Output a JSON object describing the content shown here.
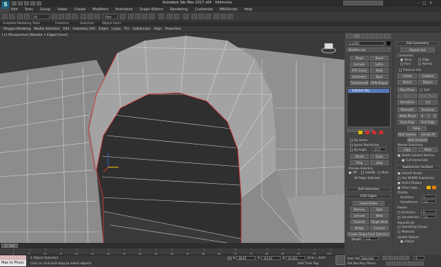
{
  "app": {
    "title": "Autodesk 3ds Max 2017 x64",
    "file": "Xdbmclsa",
    "search_placeholder": "Type a keyword or phrase"
  },
  "menu": [
    "Edit",
    "Tools",
    "Group",
    "Views",
    "Create",
    "Modifiers",
    "Animation",
    "Graph Editors",
    "Rendering",
    "Customize",
    "MAXScript",
    "Help"
  ],
  "toolbar": {
    "selection_filter": "All",
    "coord_system": "View"
  },
  "ribbon": {
    "tabs": [
      "Graphite Modeling Tools",
      "Freeform",
      "Selection",
      "Object Paint"
    ],
    "row": [
      "Polygon Modeling",
      "Modify Selection",
      "Edit",
      "Geometry (All)",
      "Edges",
      "Loops",
      "Tris",
      "Subdivision",
      "Align",
      "Properties"
    ]
  },
  "viewport": {
    "label": "[+] [Perspective] [Shaded + Edged Faces]"
  },
  "command_panel": {
    "object_name": "Line001",
    "modifier_list": "Modifier List",
    "buttons": [
      "Bend",
      "Bevel",
      "Extrude",
      "Lathe",
      "FFD 2x2x2",
      "Shell",
      "Symmetry",
      "Taper",
      "TurboSmooth",
      "UVW Mapping Cle"
    ],
    "stack_item": "Editable Poly",
    "selection": {
      "by_vertex": "By Vertex",
      "ignore_backfacing": "Ignore Backfacing",
      "by_angle": "By Angle",
      "angle_value": "45.0",
      "shrink": "Shrink",
      "grow": "Grow",
      "ring": "Ring",
      "loop": "Loop",
      "preview_selection": "Preview Selection",
      "off": "Off",
      "subobj": "SubObj",
      "multi": "Multi",
      "status": "80 Edges Selected"
    },
    "soft_selection": "Soft Selection",
    "edit_edges": {
      "header": "Edit Edges",
      "insert_vertex": "Insert Vertex",
      "remove": "Remove",
      "split": "Split",
      "extrude": "Extrude",
      "weld": "Weld",
      "chamfer": "Chamfer",
      "target_weld": "Target Weld",
      "bridge": "Bridge",
      "connect": "Connect",
      "create_shape": "Create Shape From Selection",
      "weight_label": "Weight:",
      "weight_value": "1.0",
      "crease_label": "Crease:",
      "crease_value": "0.0"
    }
  },
  "edit_geometry": {
    "header": "Edit Geometry",
    "repeat_last": "Repeat Last",
    "constraints": "Constraints",
    "none": "None",
    "edge": "Edge",
    "face": "Face",
    "normal": "Normal",
    "preserve_uvs": "Preserve UVs",
    "create": "Create",
    "collapse": "Collapse",
    "attach": "Attach",
    "detach": "Detach",
    "slice_plane": "Slice Plane",
    "split": "Split",
    "slice": "Slice",
    "reset_plane": "Reset Plane",
    "quickslice": "QuickSlice",
    "cut": "Cut",
    "msmooth": "MSmooth",
    "tessellate": "Tessellate",
    "make_planar": "Make Planar",
    "x": "X",
    "y": "Y",
    "z": "Z",
    "view_align": "View Align",
    "grid_align": "Grid Align",
    "relax": "Relax",
    "hide_selected": "Hide Selected",
    "unhide_all": "Unhide All",
    "hide_unselected": "Hide Unselected",
    "named_selections": "Named Selections:",
    "copy": "Copy",
    "paste": "Paste",
    "delete_isolated": "Delete Isolated Vertices",
    "full_interactivity": "Full Interactivity"
  },
  "subdivision_surface": {
    "header": "Subdivision Surface",
    "smooth_result": "Smooth Result",
    "use_nurms": "Use NURMS Subdivision",
    "isoline_display": "Isoline Display",
    "show_cage": "Show Cage......",
    "display": "Display",
    "iterations_label": "Iterations:",
    "iterations_value": "1",
    "smoothness_label": "Smoothness:",
    "smoothness_value": "1.0",
    "render": "Render",
    "r_iterations_value": "0",
    "r_smoothness_value": "1.0",
    "separate_by": "Separate By",
    "smoothing_groups": "Smoothing Groups",
    "materials": "Materials",
    "update_options": "Update Options",
    "always": "Always",
    "when_rendering": "When Rendering",
    "manually": "Manually",
    "cage_colors": [
      "#e0b000",
      "#e08000"
    ]
  },
  "timeline": {
    "counter": "0 / 100",
    "ticks": [
      "0",
      "5",
      "10",
      "15",
      "20",
      "25",
      "30",
      "35",
      "40",
      "45",
      "50",
      "55",
      "60",
      "65",
      "70",
      "75",
      "80",
      "85",
      "90",
      "95",
      "100"
    ]
  },
  "status": {
    "maxscript": "Max to Physc",
    "objects_selected": "1 Object Selected",
    "prompt": "Click or click-and-drag to select objects",
    "x_label": "X:",
    "x_value": "38.87",
    "y_label": "Y:",
    "y_value": "-8.214",
    "z_label": "Z:",
    "z_value": "23.651",
    "grid": "Grid = 10.0",
    "add_time_tag": "Add Time Tag",
    "auto_key": "Auto Key",
    "set_key": "Set Key",
    "key_mode": "Selected",
    "key_filters": "Key Filters...",
    "frame": "0"
  }
}
